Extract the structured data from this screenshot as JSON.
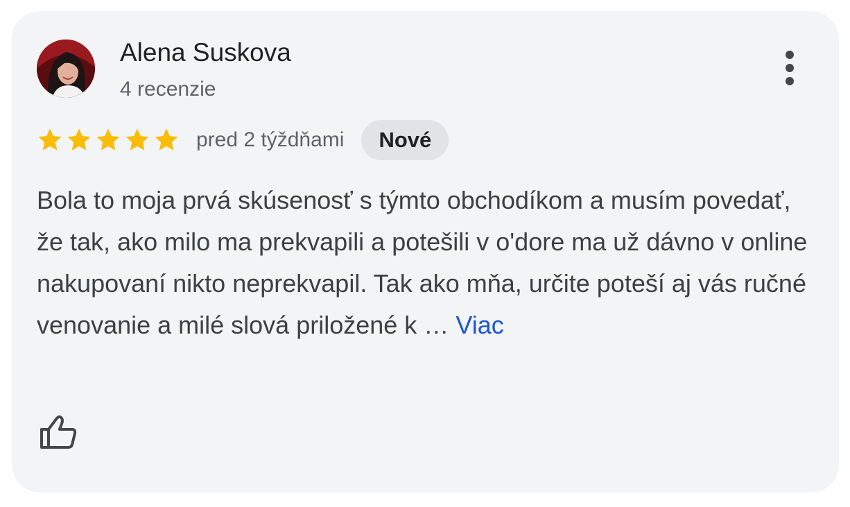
{
  "review": {
    "author_name": "Alena Suskova",
    "review_count": "4 recenzie",
    "rating": 5,
    "rating_max": 5,
    "date": "pred 2 týždňami",
    "badge": "Nové",
    "text": "Bola to moja prvá skúsenosť s týmto obchodíkom a musím povedať, že tak, ako milo ma prekvapili a potešili v o'dore ma už dávno v online nakupovaní nikto neprekvapil. Tak ako mňa, určite poteší aj vás ručné venovanie a milé slová priložené k …",
    "more_label": "Viac"
  },
  "icons": {
    "avatar": "avatar-photo",
    "more": "more-vert-icon",
    "star": "star-icon",
    "like": "thumb-up-icon"
  },
  "colors": {
    "card_background": "#f3f4f6",
    "star": "#fbbc04",
    "link": "#1a57d3",
    "badge_background": "#e1e3e6"
  }
}
